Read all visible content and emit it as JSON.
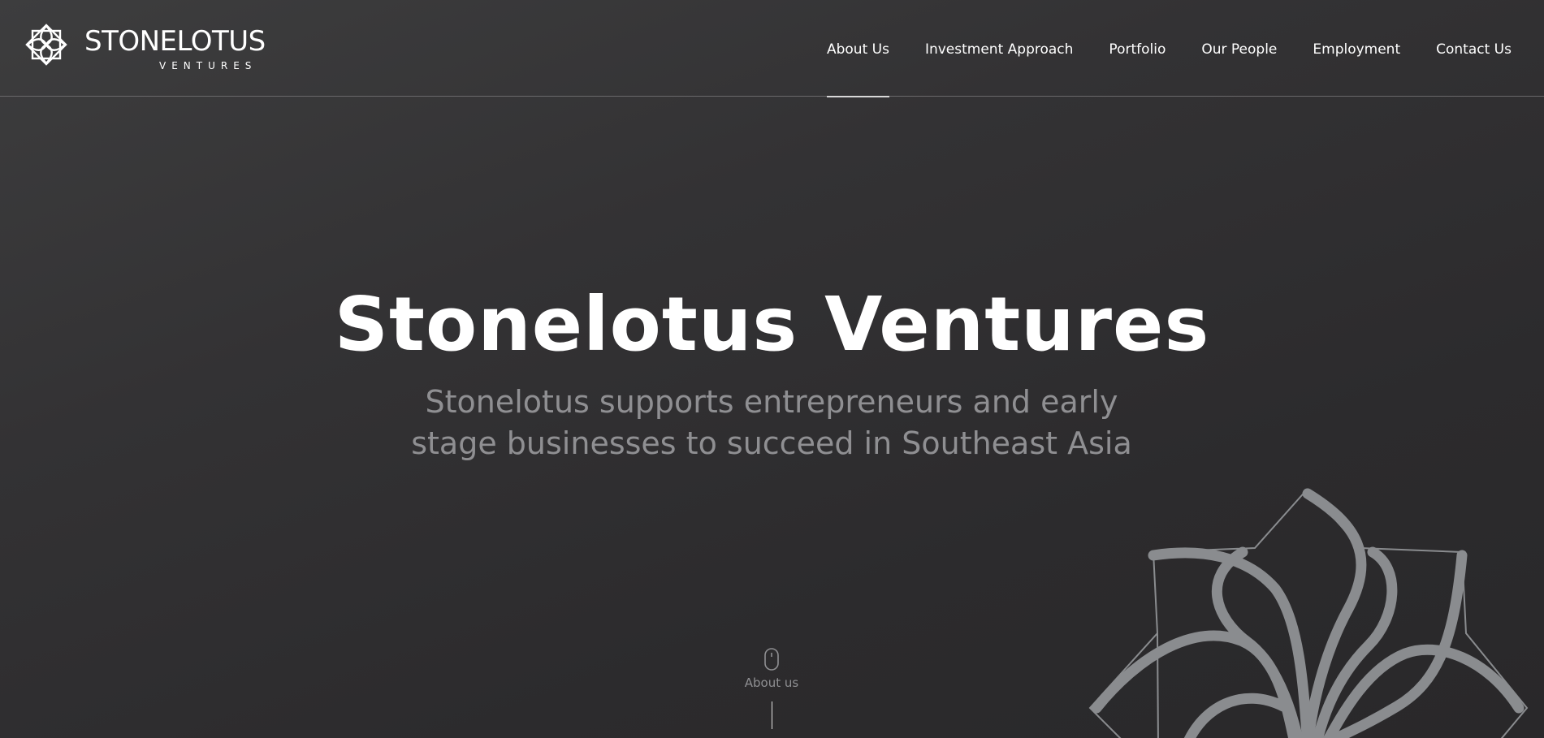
{
  "brand": {
    "name": "STONELOTUS",
    "subtitle": "VENTURES"
  },
  "nav": {
    "items": [
      {
        "label": "About Us",
        "active": true
      },
      {
        "label": "Investment Approach",
        "active": false
      },
      {
        "label": "Portfolio",
        "active": false
      },
      {
        "label": "Our People",
        "active": false
      },
      {
        "label": "Employment",
        "active": false
      },
      {
        "label": "Contact Us",
        "active": false
      }
    ]
  },
  "hero": {
    "title": "Stonelotus Ventures",
    "subtitle_line1": "Stonelotus supports entrepreneurs and early",
    "subtitle_line2": "stage businesses to succeed in Southeast Asia"
  },
  "scroll": {
    "label": "About us",
    "icon": "mouse-icon"
  },
  "colors": {
    "background": "#2e2d2f",
    "text": "#ffffff",
    "muted_text": "#8f8f92",
    "lotus": "#8a8c8f",
    "divider": "#6a696b"
  }
}
